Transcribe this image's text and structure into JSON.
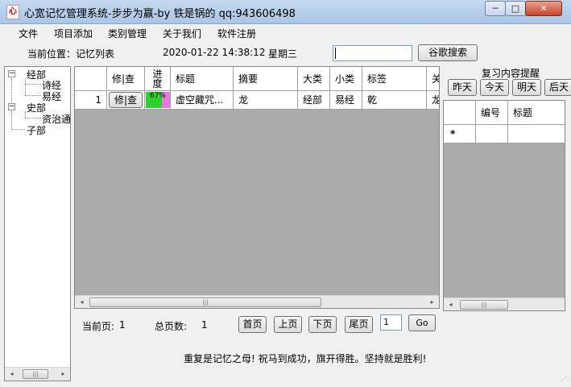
{
  "window": {
    "title": "心宽记忆管理系统-步步为赢-by 铁是锅的 qq:943606498",
    "icon_text": "心",
    "min_glyph": "─",
    "max_glyph": "□",
    "close_glyph": "✕"
  },
  "menu": [
    "文件",
    "项目添加",
    "类别管理",
    "关于我们",
    "软件注册"
  ],
  "location": {
    "label": "当前位置：记忆列表",
    "datetime": "2020-01-22 14:38:12",
    "weekday": "星期三",
    "search_value": "",
    "search_button": "谷歌搜索"
  },
  "tree": {
    "expanded_glyph": "−",
    "nodes": [
      {
        "label": "经部",
        "children": [
          "诗经",
          "易经"
        ]
      },
      {
        "label": "史部",
        "children": [
          "资治通"
        ]
      },
      {
        "label": "子部",
        "children": []
      }
    ]
  },
  "grid": {
    "columns": [
      "修|查",
      "进度",
      "标题",
      "摘要",
      "大类",
      "小类",
      "标签",
      "关"
    ],
    "rows": [
      {
        "row_num": "1",
        "action": "修|查",
        "progress_text": "67%",
        "progress": 0.67,
        "title": "虚空藏咒...",
        "summary": "龙",
        "category": "经部",
        "subcategory": "易经",
        "tag": "乾",
        "extra": "龙"
      }
    ]
  },
  "pagination": {
    "current_label": "当前页:",
    "current_value": "1",
    "total_label": "总页数:",
    "total_value": "1",
    "first": "首页",
    "prev": "上页",
    "next": "下页",
    "last": "尾页",
    "page_input": "1",
    "go": "Go"
  },
  "review": {
    "title": "复习内容提醒",
    "buttons": [
      "昨天",
      "今天",
      "明天",
      "后天"
    ],
    "columns": [
      "编号",
      "标题"
    ],
    "new_row_marker": "*"
  },
  "scroll": {
    "left": "◂",
    "right": "▸",
    "thumb": "|||"
  },
  "footer": "重复是记忆之母! 祝马到成功，旗开得胜。坚持就是胜利!",
  "colors": {
    "progress_done": "#2fd12f",
    "progress_remaining": "#e878e0",
    "titlebar": "#b8cfe8"
  }
}
